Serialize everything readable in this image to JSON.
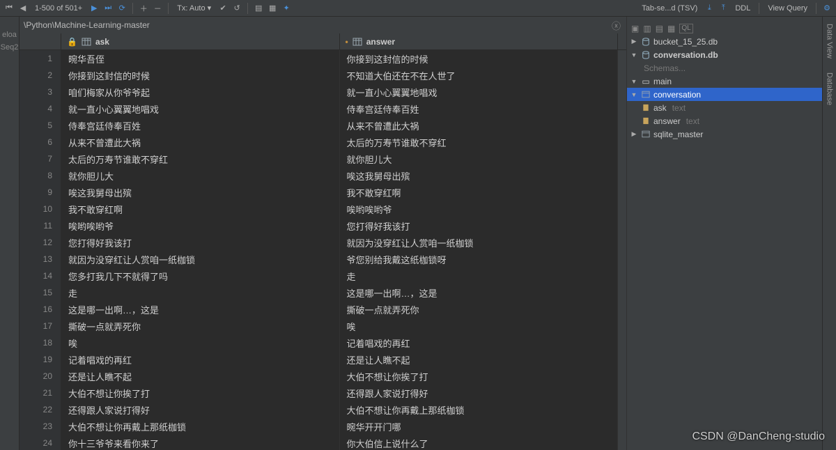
{
  "toolbar": {
    "page_info": "1-500 of 501+",
    "tx_label": "Tx: Auto",
    "tab_sep": "Tab-se...d (TSV)",
    "ddl": "DDL",
    "view_query": "View Query"
  },
  "breadcrumb": "\\Python\\Machine-Learning-master",
  "left_items": [
    "eloa",
    "Seq2"
  ],
  "columns": {
    "ask": "ask",
    "answer": "answer"
  },
  "rows": [
    {
      "n": 1,
      "ask": "晼华吾侄",
      "answer": "你接到这封信的时候"
    },
    {
      "n": 2,
      "ask": "你接到这封信的时候",
      "answer": "不知道大伯还在不在人世了"
    },
    {
      "n": 3,
      "ask": "咱们梅家从你爷爷起",
      "answer": "就一直小心翼翼地唱戏"
    },
    {
      "n": 4,
      "ask": "就一直小心翼翼地唱戏",
      "answer": "侍奉宫廷侍奉百姓"
    },
    {
      "n": 5,
      "ask": "侍奉宫廷侍奉百姓",
      "answer": "从来不曾遭此大祸"
    },
    {
      "n": 6,
      "ask": "从来不曾遭此大祸",
      "answer": "太后的万寿节谁敢不穿红"
    },
    {
      "n": 7,
      "ask": "太后的万寿节谁敢不穿红",
      "answer": "就你胆儿大"
    },
    {
      "n": 8,
      "ask": "就你胆儿大",
      "answer": "唉这我舅母出殡"
    },
    {
      "n": 9,
      "ask": "唉这我舅母出殡",
      "answer": "我不敢穿红啊"
    },
    {
      "n": 10,
      "ask": "我不敢穿红啊",
      "answer": "唉哟唉哟爷"
    },
    {
      "n": 11,
      "ask": "唉哟唉哟爷",
      "answer": "您打得好我该打"
    },
    {
      "n": 12,
      "ask": "您打得好我该打",
      "answer": "就因为没穿红让人赏咱一纸枷锁"
    },
    {
      "n": 13,
      "ask": "就因为没穿红让人赏咱一纸枷锁",
      "answer": "爷您别给我戴这纸枷锁呀"
    },
    {
      "n": 14,
      "ask": "您多打我几下不就得了吗",
      "answer": "走"
    },
    {
      "n": 15,
      "ask": "走",
      "answer": "这是哪一出啊…，这是"
    },
    {
      "n": 16,
      "ask": "这是哪一出啊…，这是",
      "answer": "撕破一点就弄死你"
    },
    {
      "n": 17,
      "ask": "撕破一点就弄死你",
      "answer": "唉"
    },
    {
      "n": 18,
      "ask": "唉",
      "answer": "记着唱戏的再红"
    },
    {
      "n": 19,
      "ask": "记着唱戏的再红",
      "answer": "还是让人瞧不起"
    },
    {
      "n": 20,
      "ask": "还是让人瞧不起",
      "answer": "大伯不想让你挨了打"
    },
    {
      "n": 21,
      "ask": "大伯不想让你挨了打",
      "answer": "还得跟人家说打得好"
    },
    {
      "n": 22,
      "ask": "还得跟人家说打得好",
      "answer": "大伯不想让你再戴上那纸枷锁"
    },
    {
      "n": 23,
      "ask": "大伯不想让你再戴上那纸枷锁",
      "answer": "晼华开开门哪"
    },
    {
      "n": 24,
      "ask": "你十三爷爷来看你来了",
      "answer": "你大伯信上说什么了"
    }
  ],
  "tree": {
    "db1": "bucket_15_25.db",
    "db2": "conversation.db",
    "schemas": "Schemas...",
    "main": "main",
    "conversation": "conversation",
    "ask_col": "ask",
    "ask_type": "text",
    "answer_col": "answer",
    "answer_type": "text",
    "sqlite_master": "sqlite_master"
  },
  "side_tabs": {
    "data_view": "Data View",
    "database": "Database"
  },
  "watermark": "CSDN @DanCheng-studio"
}
